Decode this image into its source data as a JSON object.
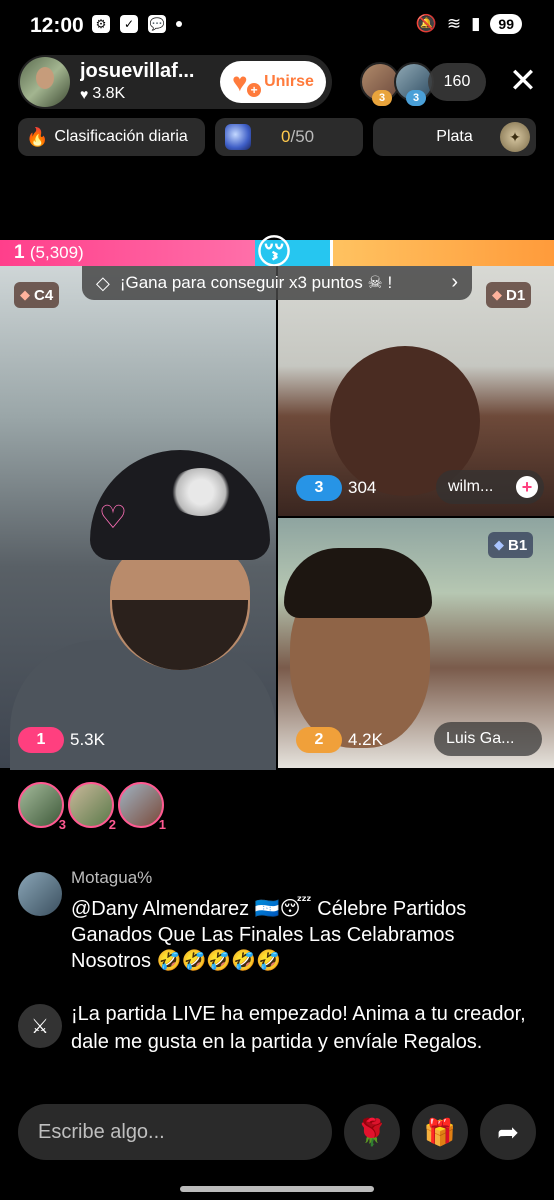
{
  "status_bar": {
    "time": "12:00",
    "battery": "99",
    "icons_left": [
      "app-icon",
      "check-icon",
      "chat-icon",
      "dot-icon"
    ],
    "icons_right": [
      "mute-icon",
      "wifi-icon",
      "signal-icon"
    ]
  },
  "host": {
    "name": "josuevillaf...",
    "likes": "3.8K",
    "join_label": "Unirse"
  },
  "viewers": {
    "top_ranks": [
      "3",
      "3"
    ],
    "count": "160"
  },
  "chips": {
    "daily_ranking": "Clasificación diaria",
    "goal_current": "0",
    "goal_total": "/50",
    "league": "Plata"
  },
  "battle": {
    "rank": "1",
    "points": "(5,309)",
    "banner": "¡Gana para conseguir x3 puntos",
    "banner_suffix": "!"
  },
  "tiles": {
    "main": {
      "tag": "C4",
      "rank": "1",
      "score": "5.3K"
    },
    "top_right": {
      "tag": "D1",
      "rank": "3",
      "score": "304",
      "name": "wilm..."
    },
    "bottom_right": {
      "tag": "B1",
      "rank": "2",
      "score": "4.2K",
      "name": "Luis Ga..."
    }
  },
  "gifters": [
    {
      "rank": "3"
    },
    {
      "rank": "2"
    },
    {
      "rank": "1"
    }
  ],
  "chat": [
    {
      "user": "Motagua%",
      "text": "@Dany Almendarez 🇭🇳😴  Célebre Partidos Ganados Que Las Finales Las Celabramos Nosotros 🤣🤣🤣🤣🤣"
    },
    {
      "user": "",
      "text": "¡La partida LIVE ha empezado! Anima a tu creador, dale me gusta en la partida y envíale Regalos."
    }
  ],
  "bottom": {
    "comment_placeholder": "Escribe algo..."
  },
  "colors": {
    "pink": "#ff3f8b",
    "blue": "#26c6f0",
    "orange": "#ff9b3b",
    "join_accent": "#ff7b3c"
  }
}
